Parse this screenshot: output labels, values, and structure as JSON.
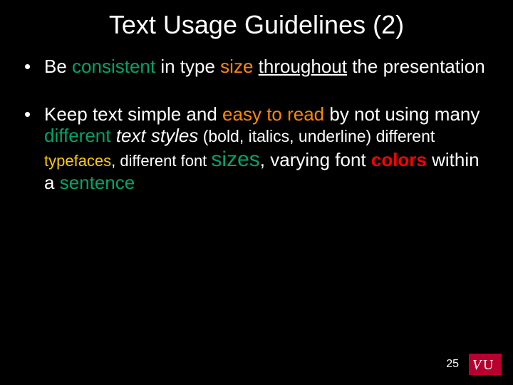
{
  "title": "Text Usage Guidelines (2)",
  "b1": {
    "p1": "Be ",
    "consistent": "consistent",
    "p2": " in type ",
    "size": "size",
    "p3": " ",
    "throughout": "throughout",
    "p4": " the presentation"
  },
  "b2": {
    "p1": "Keep text simple and ",
    "easy": "easy to read",
    "p2": " by not using many ",
    "different1": "different",
    "p3": " ",
    "textstyles": "text styles",
    "p4": " (bold, italics, underline) different ",
    "typefaces": "typefaces",
    "p5": ", different font ",
    "sizes": "sizes",
    "p6": ", varying font ",
    "colors": "colors",
    "p7": " within a ",
    "sentence": "sentence"
  },
  "page_number": "25",
  "logo_text": "VU"
}
